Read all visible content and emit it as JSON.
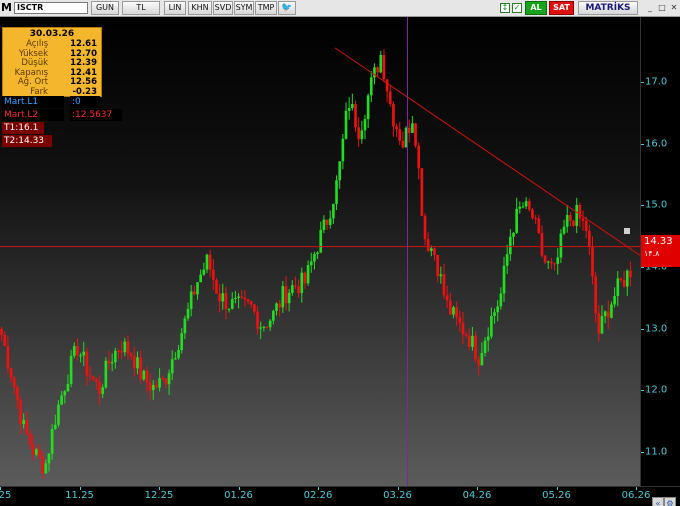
{
  "toolbar": {
    "logo": "M",
    "symbol": "ISCTR",
    "buttons": [
      "GUN",
      "TL",
      "LIN",
      "KHN",
      "SVD",
      "SYM",
      "TMP"
    ],
    "twitter_icon": "🐦",
    "scroll_icon": "↕",
    "check_icon": "✓",
    "buy_label": "AL",
    "sell_label": "SAT",
    "brand": "MATRİKS",
    "minimize_icon": "_",
    "maximize_icon": "□",
    "close_icon": "✕"
  },
  "info": {
    "date": "30.03.26",
    "rows": [
      {
        "label": "Açılış",
        "value": "12.61"
      },
      {
        "label": "Yüksek",
        "value": "12.70"
      },
      {
        "label": "Düşük",
        "value": "12.39"
      },
      {
        "label": "Kapanış",
        "value": "12.41"
      },
      {
        "label": "Ağ. Ort",
        "value": "12.56"
      },
      {
        "label": "Fark",
        "value": "-0.23"
      }
    ]
  },
  "indicators": [
    {
      "label": "Mart.L1",
      "value": ":0"
    },
    {
      "label": "Mart.L2",
      "value": ":12.5637"
    }
  ],
  "targets": [
    "T1:16.1",
    "T2:14.33"
  ],
  "price_tag": {
    "value": "14.33",
    "sub": "۱۴.۸"
  },
  "scroll": {
    "left_icon": "«",
    "right_icon": "⚙"
  },
  "colors": {
    "up": "#22dd22",
    "down": "#ee1111",
    "trendline": "#d01010",
    "hline": "#d01010",
    "cursor_vline": "#7a2a9a",
    "axis_text": "#4ac8d8"
  },
  "chart_data": {
    "type": "candlestick",
    "symbol": "ISCTR",
    "x_ticks": [
      "25",
      "11.25",
      "12.25",
      "01.26",
      "02.26",
      "03.26",
      "04.26",
      "05.26",
      "06.26"
    ],
    "y_ticks": [
      11,
      12,
      13,
      14,
      15,
      16,
      17
    ],
    "ylim": [
      10.45,
      18.05
    ],
    "hline": 14.33,
    "trendline": {
      "from": {
        "x": "02.26",
        "y": 17.55
      },
      "to": {
        "x": "06.26",
        "y": 14.1
      }
    },
    "cursor_date": "03.26",
    "series": [
      {
        "name": "close",
        "values": [
          12.9,
          12.2,
          11.4,
          11.0,
          10.75,
          11.6,
          12.2,
          12.7,
          12.3,
          12.0,
          12.5,
          12.75,
          12.6,
          12.2,
          12.05,
          12.15,
          12.65,
          13.15,
          13.75,
          14.1,
          13.55,
          13.4,
          13.35,
          13.35,
          13.05,
          13.2,
          13.55,
          13.7,
          13.75,
          14.3,
          14.75,
          15.4,
          16.7,
          16.2,
          16.9,
          17.45,
          16.5,
          16.0,
          16.5,
          14.5,
          14.2,
          13.4,
          13.1,
          12.9,
          12.55,
          13.1,
          13.5,
          14.6,
          15.0,
          14.8,
          14.1,
          13.9,
          14.7,
          14.85,
          14.6,
          12.9,
          13.35,
          13.7,
          13.95
        ]
      }
    ]
  }
}
